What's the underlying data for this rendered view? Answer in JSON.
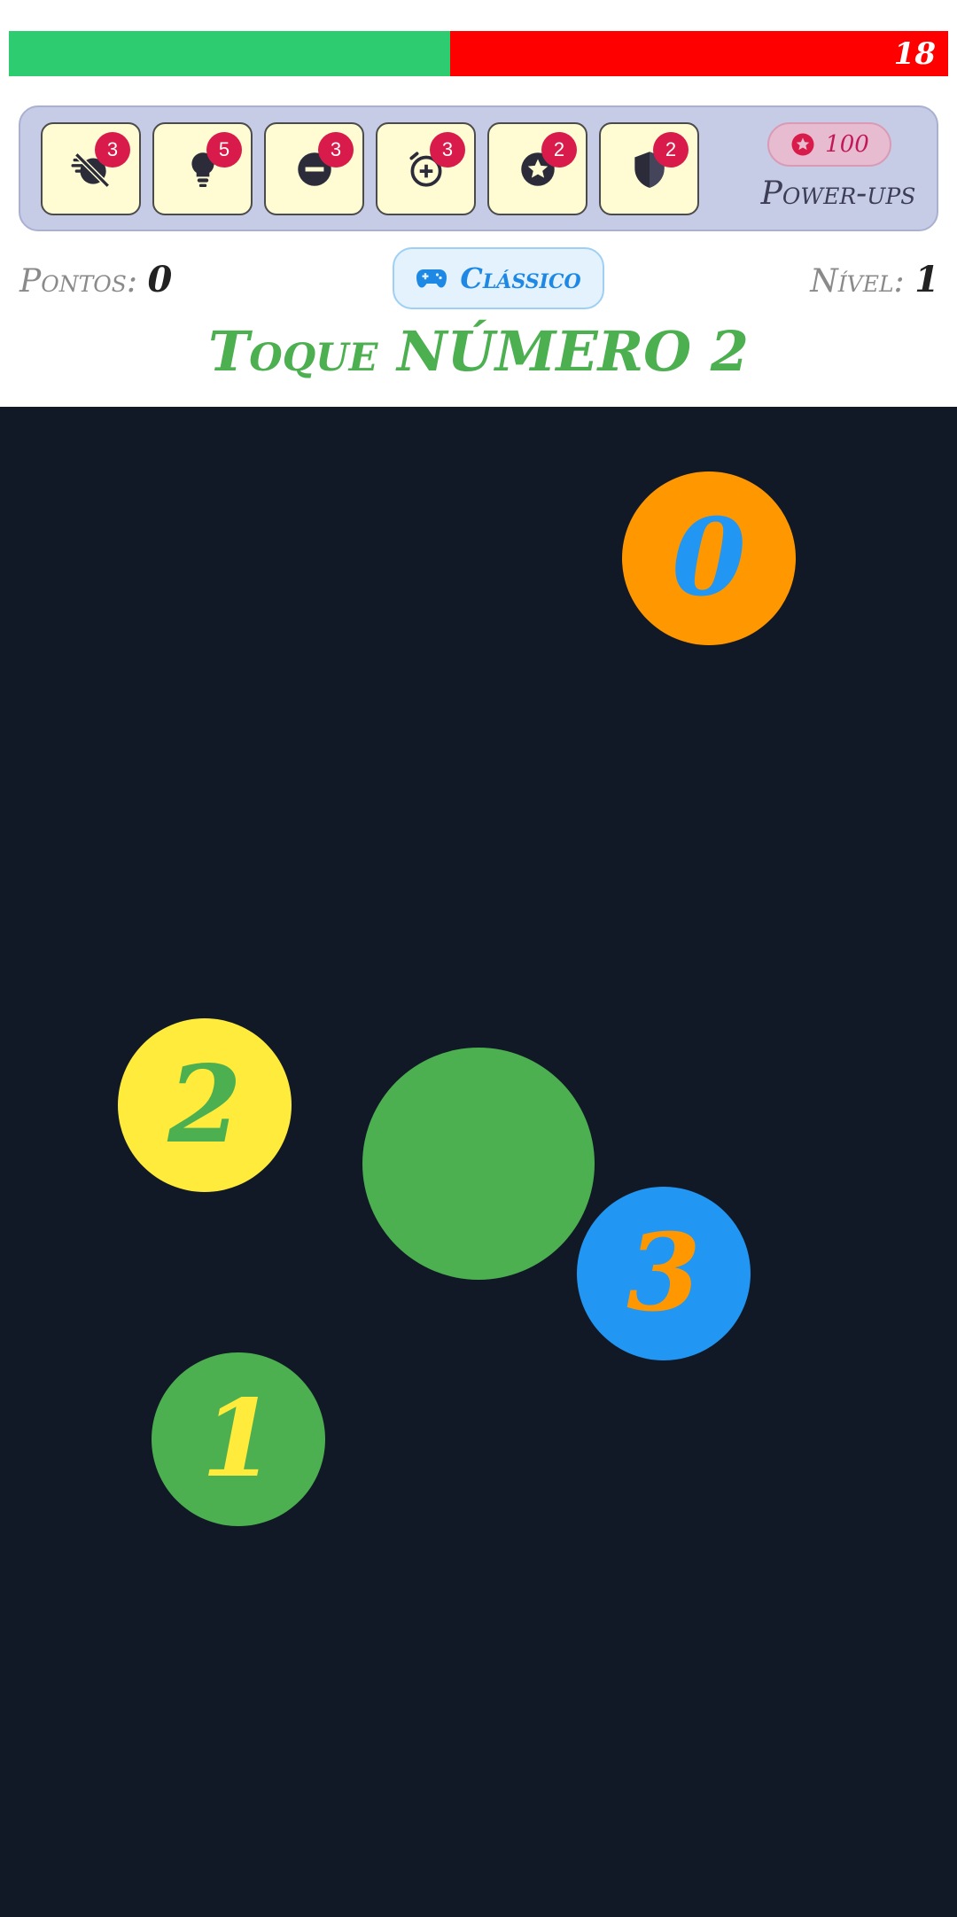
{
  "timer": {
    "seconds_left": "18",
    "remaining_fraction": 0.47,
    "fill_color": "#2ecc71",
    "track_color": "#ff0000"
  },
  "powerups": {
    "label": "Power-ups",
    "coins": "100",
    "coin_icon": "star-coin-icon",
    "items": [
      {
        "icon": "slow-time-icon",
        "count": "3"
      },
      {
        "icon": "lightbulb-hint-icon",
        "count": "5"
      },
      {
        "icon": "minus-circle-icon",
        "count": "3"
      },
      {
        "icon": "add-time-icon",
        "count": "3"
      },
      {
        "icon": "star-bonus-icon",
        "count": "2"
      },
      {
        "icon": "shield-icon",
        "count": "2"
      }
    ]
  },
  "status": {
    "score_label": "Pontos:",
    "score_value": "0",
    "mode_label": "Clássico",
    "mode_icon": "gamepad-icon",
    "level_label": "Nível:",
    "level_value": "1"
  },
  "instruction": "Toque NÚMERO 2",
  "game": {
    "background": "#111926",
    "bubbles": [
      {
        "label": "0",
        "bg": "#ff9800",
        "fg": "#2196f3"
      },
      {
        "label": "2",
        "bg": "#ffeb3b",
        "fg": "#4caf50"
      },
      {
        "label": "",
        "bg": "#4caf50",
        "fg": "#4caf50"
      },
      {
        "label": "3",
        "bg": "#2196f3",
        "fg": "#ff9800"
      },
      {
        "label": "1",
        "bg": "#4caf50",
        "fg": "#ffeb3b"
      }
    ]
  }
}
